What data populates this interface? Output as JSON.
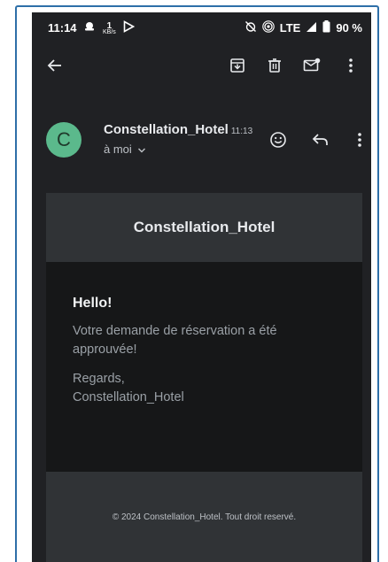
{
  "status": {
    "time": "11:14",
    "net_speed_value": "1",
    "net_speed_unit": "KB/s",
    "network": "LTE",
    "battery": "90 %"
  },
  "sender": {
    "avatar_letter": "C",
    "name": "Constellation_Hotel",
    "time": "11:13",
    "recipient": "à moi"
  },
  "email": {
    "header_title": "Constellation_Hotel",
    "greeting": "Hello!",
    "message_line1": "Votre demande de réservation a été",
    "message_line2": "approuvée!",
    "regards": "Regards,",
    "signature": "Constellation_Hotel",
    "footer": "© 2024 Constellation_Hotel. Tout droit reservé."
  },
  "colors": {
    "background": "#202124",
    "avatar": "#5bb98c",
    "frame": "#2e6fa8"
  },
  "icons": {
    "toolbar": [
      "back-arrow-icon",
      "archive-icon",
      "trash-icon",
      "mark-unread-icon",
      "more-vert-icon"
    ],
    "sender": [
      "emoji-icon",
      "reply-icon",
      "more-vert-icon"
    ]
  }
}
